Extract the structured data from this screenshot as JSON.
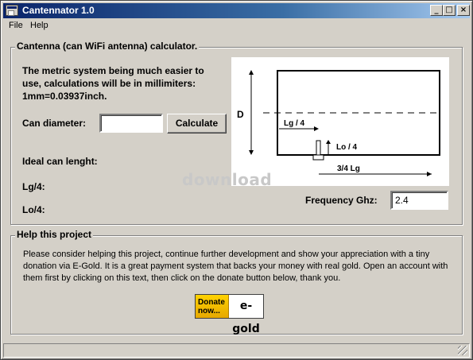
{
  "window": {
    "title": "Cantennator 1.0",
    "minimize_glyph": "_",
    "maximize_glyph": "□",
    "close_glyph": "×"
  },
  "menu": {
    "file": "File",
    "help": "Help"
  },
  "calculator": {
    "group_title": "Cantenna (can WiFi antenna) calculator.",
    "description": "The metric system being much easier to use, calculations will be in millimiters: 1mm=0.03937inch.",
    "can_diameter_label": "Can diameter:",
    "can_diameter_value": "",
    "calculate_label": "Calculate",
    "ideal_label": "Ideal can lenght:",
    "lg4_label": "Lg/4:",
    "lo4_label": "Lo/4:",
    "frequency_label": "Frequency Ghz:",
    "frequency_value": "2.4"
  },
  "diagram": {
    "d_label": "D",
    "lg4_label": "Lg / 4",
    "lo4_label": "Lo / 4",
    "lg34_label": "3/4 Lg"
  },
  "watermark": "download",
  "help_project": {
    "group_title": "Help this project",
    "text": "Please consider helping this project, continue further development and show your appreciation with a tiny donation via E-Gold. It is a great payment system that backs your money with real gold. Open an account with them first by clicking on this text, then click on the donate button below, thank you.",
    "donate_left": "Donate now...",
    "donate_right": "e-gold"
  },
  "colors": {
    "title_gradient_start": "#0a246a",
    "title_gradient_end": "#a6caf0",
    "face": "#d4d0c8"
  }
}
